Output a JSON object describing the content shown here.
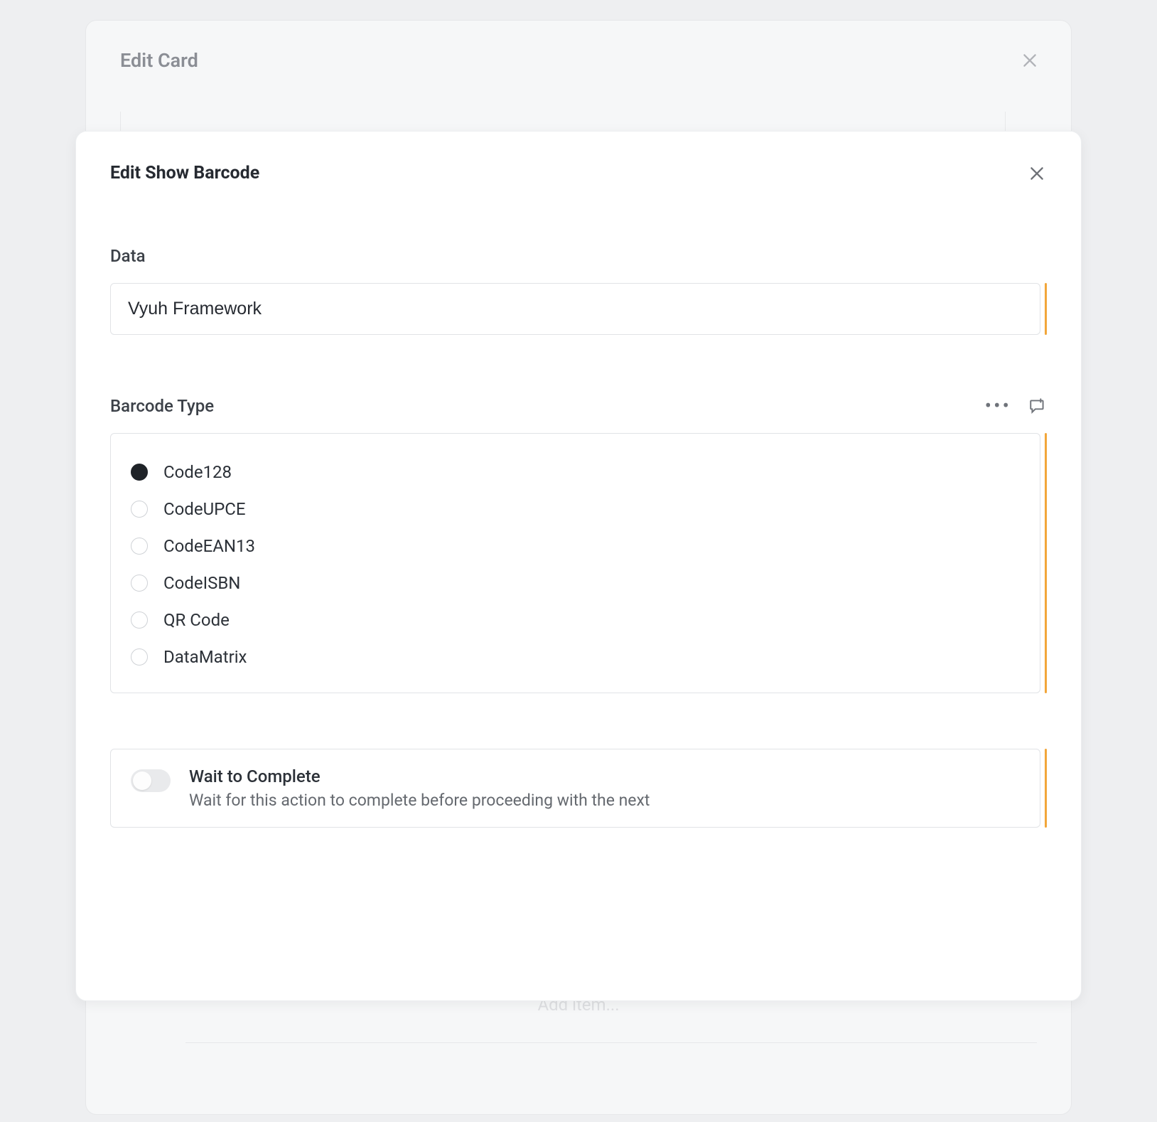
{
  "outer": {
    "title": "Edit Card",
    "ghost_add": "Add item..."
  },
  "inner": {
    "title": "Edit Show Barcode"
  },
  "data_field": {
    "label": "Data",
    "value": "Vyuh Framework"
  },
  "barcode_type": {
    "label": "Barcode Type",
    "selected": "Code128",
    "options": {
      "0": "Code128",
      "1": "CodeUPCE",
      "2": "CodeEAN13",
      "3": "CodeISBN",
      "4": "QR Code",
      "5": "DataMatrix"
    }
  },
  "wait": {
    "title": "Wait to Complete",
    "desc": "Wait for this action to complete before proceeding with the next",
    "value": false
  },
  "colors": {
    "accent": "#f2a63a"
  }
}
